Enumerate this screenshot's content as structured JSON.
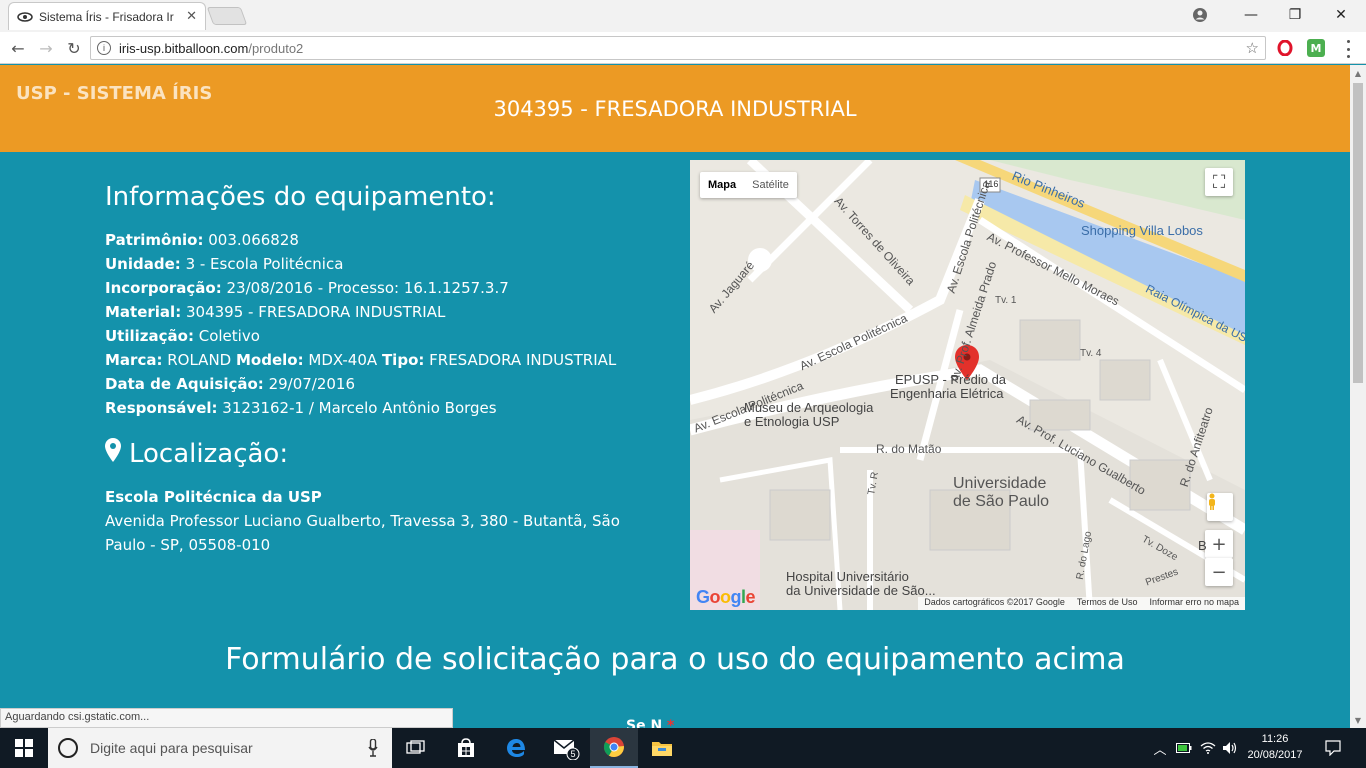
{
  "browser": {
    "tab_title": "Sistema Íris - Frisadora Ir",
    "url_host": "iris-usp.bitballoon.com",
    "url_path": "/produto2",
    "status_text": "Aguardando csi.gstatic.com..."
  },
  "header": {
    "brand": "USP - SISTEMA ÍRIS",
    "title": "304395 - FRESADORA INDUSTRIAL"
  },
  "equipment": {
    "heading": "Informações do equipamento:",
    "patrimonio_label": "Patrimônio:",
    "patrimonio": "003.066828",
    "unidade_label": "Unidade:",
    "unidade": "3 - Escola Politécnica",
    "incorporacao_label": "Incorporação:",
    "incorporacao": "23/08/2016 - Processo: 16.1.1257.3.7",
    "material_label": "Material:",
    "material": "304395 - FRESADORA INDUSTRIAL",
    "utilizacao_label": "Utilização:",
    "utilizacao": "Coletivo",
    "marca_label": "Marca:",
    "marca": "ROLAND",
    "modelo_label": "Modelo:",
    "modelo": "MDX-40A",
    "tipo_label": "Tipo:",
    "tipo": "FRESADORA INDUSTRIAL",
    "aquisicao_label": "Data de Aquisição:",
    "aquisicao": "29/07/2016",
    "responsavel_label": "Responsável:",
    "responsavel": "3123162-1 / Marcelo Antônio Borges"
  },
  "location": {
    "heading": "Localização:",
    "name": "Escola Politécnica da USP",
    "address": "Avenida Professor Luciano Gualberto, Travessa 3, 380 - Butantã, São Paulo - SP, 05508-010"
  },
  "map": {
    "type_map": "Mapa",
    "type_satellite": "Satélite",
    "labels": {
      "rio": "Rio Pinheiros",
      "shopping": "Shopping Villa Lobos",
      "raia": "Raia Olímpica da USP",
      "torres": "Av. Torres de Oliveira",
      "jaguare": "Av. Jaguaré",
      "escola_pol_1": "Av. Escola Politécnica",
      "escola_pol_2": "Av. Escola Politécnica",
      "escola_pol_3": "Av. Escola Politécnica",
      "prof_mello": "Av. Professor Mello Moraes",
      "almeida": "Av. Prof. Almeida Prado",
      "tv1": "Tv. 1",
      "tv4": "Tv. 4",
      "epusp_1": "EPUSP - Prédio da",
      "epusp_2": "Engenharia Elétrica",
      "museu_1": "Museu de Arqueologia",
      "museu_2": "e Etnologia USP",
      "matao": "R. do Matão",
      "gualberto": "Av. Prof. Luciano Gualberto",
      "usp_1": "Universidade",
      "usp_2": "de São Paulo",
      "anfiteatro": "R. do Anfiteatro",
      "tvr": "Tv. R",
      "lago": "R. do Lago",
      "tvdoze": "Tv. Doze",
      "prestes": "Prestes",
      "hospital_1": "Hospital Universitário",
      "hospital_2": "da Universidade de São...",
      "route": "116",
      "b": "B"
    },
    "attribution_data": "Dados cartográficos ©2017 Google",
    "attribution_terms": "Termos de Uso",
    "attribution_report": "Informar erro no mapa",
    "google": "Google"
  },
  "form": {
    "title": "Formulário de solicitação para o uso do equipamento acima",
    "partial_label": "Se N",
    "required_mark": "*"
  },
  "taskbar": {
    "search_placeholder": "Digite aqui para pesquisar",
    "mail_badge": "5",
    "time": "11:26",
    "date": "20/08/2017"
  }
}
